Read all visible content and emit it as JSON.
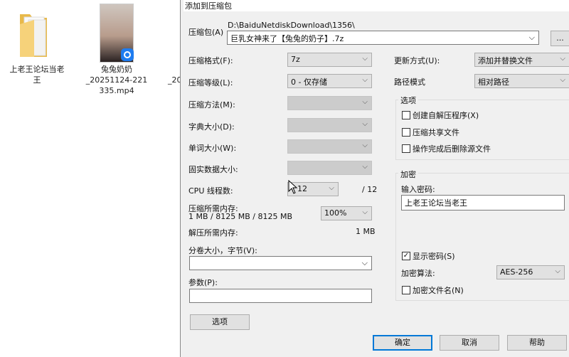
{
  "desktop": {
    "items": [
      {
        "name": "上老王论坛当老\n王",
        "icon": "folder-icon"
      },
      {
        "name": "兔兔奶奶\n_20251124-221\n335.mp4",
        "icon": "video-thumbnail"
      },
      {
        "name": "_20"
      }
    ]
  },
  "dialog": {
    "title": "添加到压缩包",
    "archive_label": "压缩包(A)",
    "archive_path": "D:\\BaiduNetdiskDownload\\1356\\",
    "archive_name": "巨乳女神来了【兔兔的奶子】.7z",
    "browse_label": "...",
    "format_label": "压缩格式(F):",
    "format_value": "7z",
    "level_label": "压缩等级(L):",
    "level_value": "0 - 仅存储",
    "method_label": "压缩方法(M):",
    "dict_label": "字典大小(D):",
    "word_label": "单词大小(W):",
    "solid_label": "固实数据大小:",
    "cpu_label": "CPU 线程数:",
    "cpu_value": "* 12",
    "cpu_max": "/ 12",
    "mem_label": "压缩所需内存:",
    "mem_value": "1 MB / 8125 MB / 8125 MB",
    "mem_pct": "100%",
    "demem_label": "解压所需内存:",
    "demem_value": "1 MB",
    "split_label": "分卷大小，字节(V):",
    "split_value": "",
    "params_label": "参数(P):",
    "params_value": "",
    "options_button": "选项",
    "update_label": "更新方式(U):",
    "update_value": "添加并替换文件",
    "path_label": "路径模式",
    "path_value": "相对路径",
    "options_group": "选项",
    "opt_sfx": "创建自解压程序(X)",
    "opt_sfx_checked": false,
    "opt_shared": "压缩共享文件",
    "opt_shared_checked": false,
    "opt_delete": "操作完成后删除源文件",
    "opt_delete_checked": false,
    "enc_group": "加密",
    "pw_label": "输入密码:",
    "pw_value": "上老王论坛当老王",
    "show_pw": "显示密码(S)",
    "show_pw_checked": true,
    "enc_method_label": "加密算法:",
    "enc_method_value": "AES-256",
    "enc_names": "加密文件名(N)",
    "enc_names_checked": false,
    "ok": "确定",
    "cancel": "取消",
    "help": "帮助"
  }
}
